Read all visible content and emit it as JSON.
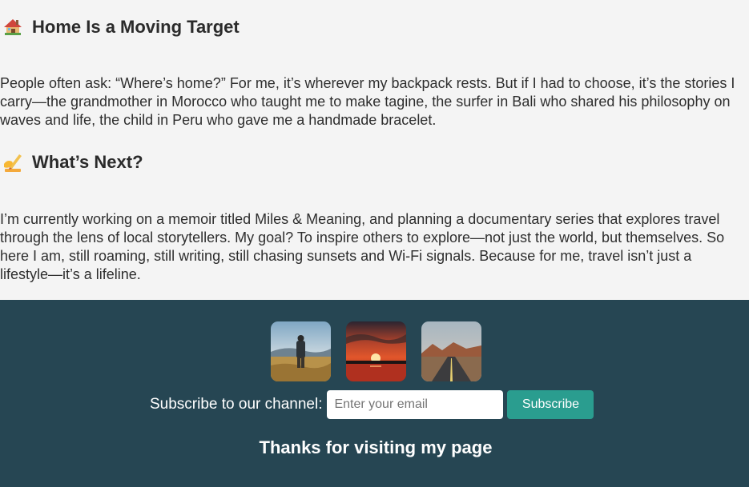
{
  "sections": [
    {
      "icon": "house-icon",
      "heading": "Home Is a Moving Target",
      "body": "People often ask: “Where’s home?” For me, it’s wherever my backpack rests. But if I had to choose, it’s the stories I carry—the grandmother in Morocco who taught me to make tagine, the surfer in Bali who shared his philosophy on waves and life, the child in Peru who gave me a handmade bracelet."
    },
    {
      "icon": "writing-hand-icon",
      "heading": "What’s Next?",
      "body": "I’m currently working on a memoir titled Miles & Meaning, and planning a documentary series that explores travel through the lens of local storytellers. My goal? To inspire others to explore—not just the world, but themselves. So here I am, still roaming, still writing, still chasing sunsets and Wi-Fi signals. Because for me, travel isn’t just a lifestyle—it’s a lifeline."
    }
  ],
  "footer": {
    "background": "#264653",
    "thumbnails": [
      {
        "name": "traveler-in-field-thumbnail"
      },
      {
        "name": "sunset-thumbnail"
      },
      {
        "name": "desert-road-thumbnail"
      }
    ],
    "subscribe_label": "Subscribe to our channel:",
    "email_placeholder": "Enter your email",
    "email_value": "",
    "subscribe_button": "Subscribe",
    "button_color": "#2a9d8f",
    "thanks": "Thanks for visiting my page"
  }
}
